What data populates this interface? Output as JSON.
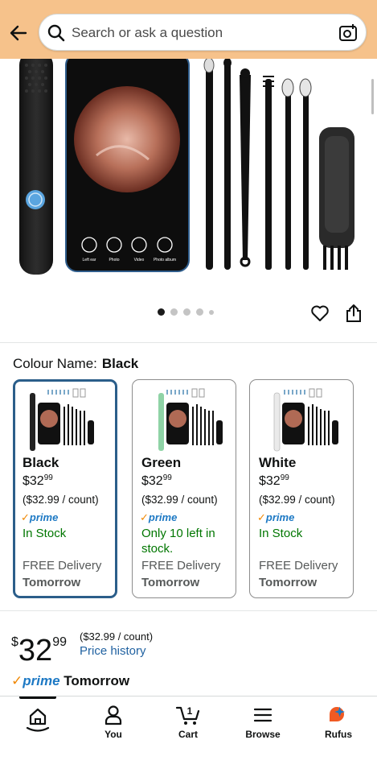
{
  "header": {
    "search_placeholder": "Search or ask a question"
  },
  "gallery": {
    "images_count": 5,
    "active_index": 0,
    "phone_labels": [
      "Left ear",
      "Photo",
      "Video",
      "Photo album"
    ]
  },
  "variants": {
    "label": "Colour Name:",
    "selected_value": "Black",
    "options": [
      {
        "name": "Black",
        "price_whole": "32",
        "price_cents": "99",
        "price_symbol": "$",
        "unit_price": "($32.99 / count)",
        "prime": "prime",
        "stock": "In Stock",
        "delivery": "FREE Delivery",
        "when": "Tomorrow",
        "selected": true,
        "wand_color": "#222222"
      },
      {
        "name": "Green",
        "price_whole": "32",
        "price_cents": "99",
        "price_symbol": "$",
        "unit_price": "($32.99 / count)",
        "prime": "prime",
        "stock": "Only 10 left in stock.",
        "delivery": "FREE Delivery",
        "when": "Tomorrow",
        "selected": false,
        "wand_color": "#8fd3a6"
      },
      {
        "name": "White",
        "price_whole": "32",
        "price_cents": "99",
        "price_symbol": "$",
        "unit_price": "($32.99 / count)",
        "prime": "prime",
        "stock": "In Stock",
        "delivery": "FREE Delivery",
        "when": "Tomorrow",
        "selected": false,
        "wand_color": "#e8e8e8"
      }
    ]
  },
  "price": {
    "symbol": "$",
    "whole": "32",
    "cents": "99",
    "unit": "($32.99 / count)",
    "history_link": "Price history"
  },
  "delivery": {
    "prime": "prime",
    "when": "Tomorrow"
  },
  "bottom_nav": {
    "items": [
      {
        "label": "",
        "icon": "home-icon",
        "active": true
      },
      {
        "label": "You",
        "icon": "person-icon"
      },
      {
        "label": "Cart",
        "icon": "cart-icon",
        "badge": "1"
      },
      {
        "label": "Browse",
        "icon": "menu-icon"
      },
      {
        "label": "Rufus",
        "icon": "rufus-icon"
      }
    ]
  },
  "colors": {
    "header_bg": "#f6c28b",
    "selected_border": "#2b5e8a",
    "in_stock": "#007600",
    "link": "#2162a1",
    "prime_blue": "#1d79c4",
    "prime_check": "#f08804"
  }
}
